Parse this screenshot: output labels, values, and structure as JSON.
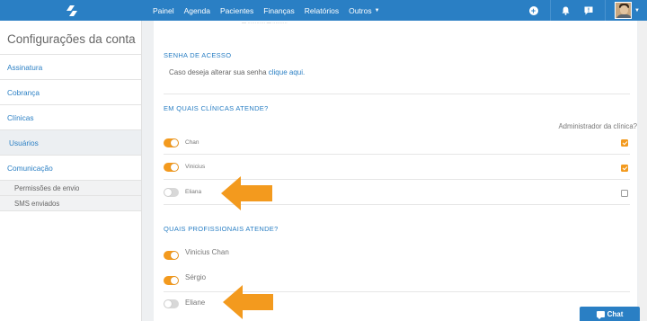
{
  "topbar": {
    "nav": [
      {
        "label": "Painel"
      },
      {
        "label": "Agenda"
      },
      {
        "label": "Pacientes"
      },
      {
        "label": "Finanças"
      },
      {
        "label": "Relatórios"
      },
      {
        "label": "Outros"
      }
    ]
  },
  "sidebar": {
    "title": "Configurações da conta",
    "items": [
      {
        "label": "Assinatura"
      },
      {
        "label": "Cobrança"
      },
      {
        "label": "Clínicas"
      },
      {
        "label": "Usuários"
      },
      {
        "label": "Comunicação"
      }
    ],
    "subitems": [
      {
        "label": "Permissões de envio"
      },
      {
        "label": "SMS enviados"
      }
    ]
  },
  "password_section": {
    "title": "SENHA DE ACESSO",
    "text": "Caso deseja alterar sua senha",
    "link": "clique aqui."
  },
  "clinics_section": {
    "title": "EM QUAIS CLÍNICAS ATENDE?",
    "admin_label": "Administrador da clínica?",
    "rows": [
      {
        "name": "Chan",
        "enabled": true,
        "admin": true
      },
      {
        "name": "Vinicius",
        "enabled": true,
        "admin": true
      },
      {
        "name": "Eliana",
        "enabled": false,
        "admin": false
      }
    ]
  },
  "professionals_section": {
    "title": "QUAIS PROFISSIONAIS ATENDE?",
    "rows": [
      {
        "name": "Vinicius Chan",
        "enabled": true
      },
      {
        "name": "Sérgio",
        "enabled": true
      },
      {
        "name": "Eliane",
        "enabled": false
      }
    ]
  },
  "chat": {
    "label": "Chat"
  },
  "colors": {
    "brand": "#2a7fc4",
    "accent": "#f39a1e"
  }
}
